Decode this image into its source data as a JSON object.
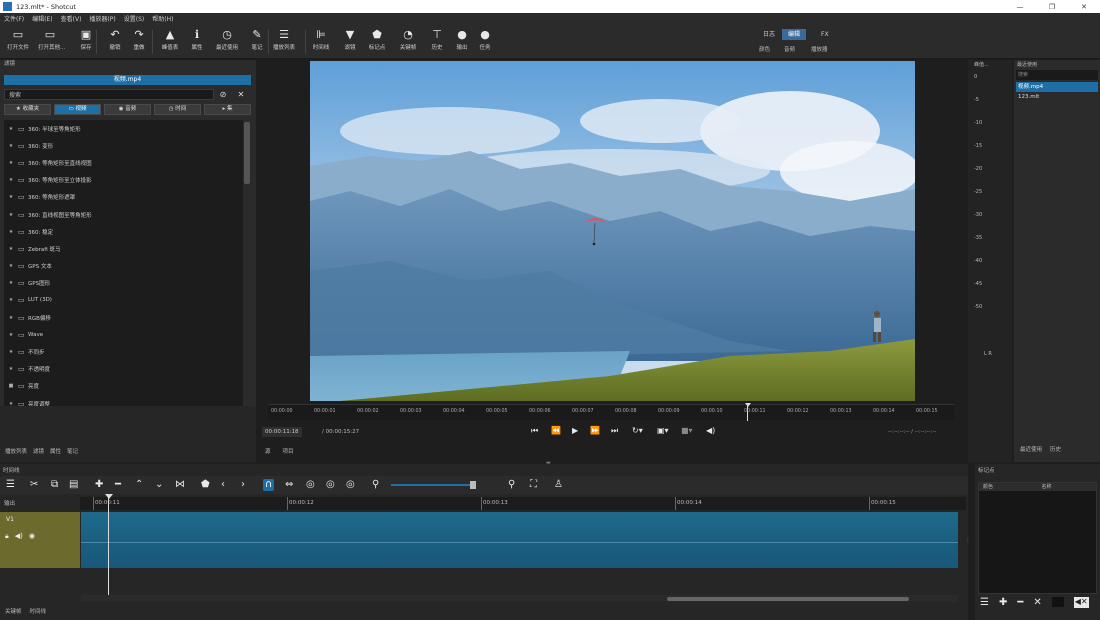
{
  "window": {
    "title": "123.mlt* - Shotcut",
    "controls": [
      "—",
      "❐",
      "✕"
    ]
  },
  "menu": [
    "文件(F)",
    "编辑(E)",
    "查看(V)",
    "播放器(P)",
    "设置(S)",
    "帮助(H)"
  ],
  "toolbar": [
    {
      "icon": "open-file-icon",
      "glyph": "▭",
      "label": "打开文件"
    },
    {
      "icon": "open-other-icon",
      "glyph": "▭",
      "label": "打开其他..."
    },
    {
      "icon": "save-icon",
      "glyph": "▣",
      "label": "保存"
    },
    {
      "icon": "undo-icon",
      "glyph": "↶",
      "label": "撤销"
    },
    {
      "icon": "redo-icon",
      "glyph": "↷",
      "label": "重做"
    },
    {
      "icon": "peak-meter-icon",
      "glyph": "▲",
      "label": "峰值表"
    },
    {
      "icon": "properties-icon",
      "glyph": "ℹ",
      "label": "属性"
    },
    {
      "icon": "recent-icon",
      "glyph": "◷",
      "label": "最近使用"
    },
    {
      "icon": "notes-icon",
      "glyph": "✎",
      "label": "笔记"
    },
    {
      "icon": "playlist-icon",
      "glyph": "☰",
      "label": "播放列表"
    },
    {
      "icon": "timeline-icon",
      "glyph": "⊫",
      "label": "时间线"
    },
    {
      "icon": "filter-icon",
      "glyph": "▼",
      "label": "滤镜"
    },
    {
      "icon": "markers-icon",
      "glyph": "⬟",
      "label": "标记点"
    },
    {
      "icon": "keyframes-icon",
      "glyph": "◔",
      "label": "关键帧"
    },
    {
      "icon": "history-icon",
      "glyph": "⊤",
      "label": "历史"
    },
    {
      "icon": "export-icon",
      "glyph": "●",
      "label": "输出"
    },
    {
      "icon": "jobs-icon",
      "glyph": "●",
      "label": "任务"
    }
  ],
  "layouts": {
    "top": [
      "日志",
      "编辑",
      "FX"
    ],
    "active": "编辑",
    "bottom": [
      "颜色",
      "音频",
      "播放器"
    ]
  },
  "filters_panel": {
    "header": "滤镜",
    "clip_name": "视频.mp4",
    "search_placeholder": "搜索",
    "tabs": [
      "收藏夹",
      "视频",
      "音频",
      "时间",
      "集"
    ],
    "active_tab": "视频",
    "items": [
      "360: 半球至等角矩形",
      "360: 变形",
      "360: 等角矩形至直线视图",
      "360: 等角矩形至立体投影",
      "360: 等角矩形遮罩",
      "360: 直线视图至等角矩形",
      "360: 稳定",
      "Zebrafi 斑马",
      "GPS 文本",
      "GPS图形",
      "LUT (3D)",
      "RGB偏移",
      "Wave",
      "不同步",
      "不透明度",
      "亮度",
      "亮度调整"
    ],
    "footer_tabs": [
      "播放列表",
      "滤镜",
      "属性",
      "笔记"
    ]
  },
  "player": {
    "ruler_ticks": [
      "00:00:00",
      "00:00:01",
      "00:00:02",
      "00:00:03",
      "00:00:04",
      "00:00:05",
      "00:00:06",
      "00:00:07",
      "00:00:08",
      "00:00:09",
      "00:00:10",
      "00:00:11",
      "00:00:12",
      "00:00:13",
      "00:00:14",
      "00:00:15"
    ],
    "current_time": "00:00:11:18",
    "duration": "/ 00:00:15:27",
    "in_out": "--:--:--:-- / --:--:--:--",
    "source_tabs": [
      "源",
      "项目"
    ]
  },
  "meter": {
    "labels": [
      "0",
      "-5",
      "-10",
      "-15",
      "-20",
      "-25",
      "-30",
      "-35",
      "-40",
      "-45",
      "-50"
    ],
    "channels": "L R",
    "header": "峰值..."
  },
  "recent": {
    "header": "最近使用",
    "search_placeholder": "搜索",
    "items": [
      "视频.mp4",
      "123.mlt"
    ],
    "selected": 0,
    "footer_tabs": [
      "最近使用",
      "历史"
    ]
  },
  "timeline": {
    "header": "时间线",
    "output_label": "输出",
    "track_name": "V1",
    "ticks": [
      "00:00:11",
      "00:00:12",
      "00:00:13",
      "00:00:14",
      "00:00:15"
    ],
    "footer_tabs": [
      "关键帧",
      "时间线"
    ]
  },
  "markers": {
    "header": "标记点",
    "columns": [
      "颜色",
      "名称"
    ]
  },
  "colors": {
    "accent": "#1e6fa5",
    "track_head": "#6d6a2d",
    "clip": "#1f6b8c",
    "panel": "#2b2b2b"
  }
}
